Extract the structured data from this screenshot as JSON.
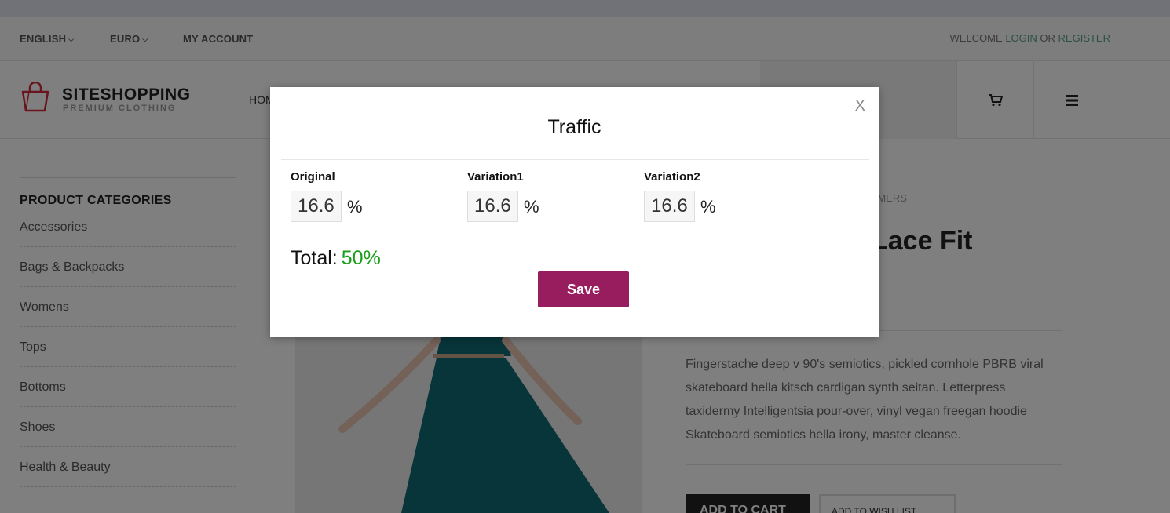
{
  "topbar": {
    "language": "ENGLISH",
    "currency": "EURO",
    "account": "MY ACCOUNT",
    "welcome": "WELCOME",
    "login": "LOGIN",
    "or": "OR",
    "register": "REGISTER"
  },
  "header": {
    "brand": "SITESHOPPING",
    "tagline": "PREMIUM CLOTHING",
    "nav_home": "HOM"
  },
  "sidebar": {
    "title": "PRODUCT CATEGORIES",
    "items": [
      "Accessories",
      "Bags & Backpacks",
      "Womens",
      "Tops",
      "Bottoms",
      "Shoes",
      "Health & Beauty"
    ]
  },
  "product": {
    "breadcrumb_fragment": "TUMERS",
    "title_fragment": "Lace Fit",
    "description": "Fingerstache deep v 90's semiotics, pickled cornhole PBRB viral skateboard hella kitsch cardigan synth seitan. Letterpress taxidermy Intelligentsia pour-over, vinyl vegan freegan hoodie Skateboard semiotics hella irony, master cleanse.",
    "add_to_cart": "ADD TO CART",
    "add_to_wishlist": "ADD TO WISH LIST"
  },
  "modal": {
    "title": "Traffic",
    "close": "X",
    "fields": [
      {
        "label": "Original",
        "value": "16.6",
        "unit": "%"
      },
      {
        "label": "Variation1",
        "value": "16.6",
        "unit": "%"
      },
      {
        "label": "Variation2",
        "value": "16.6",
        "unit": "%"
      }
    ],
    "total_label": "Total:",
    "total_value": "50%",
    "save_label": "Save"
  },
  "colors": {
    "accent": "#971d5e",
    "total_ok": "#1a9e1a",
    "link": "#5aa08a"
  }
}
